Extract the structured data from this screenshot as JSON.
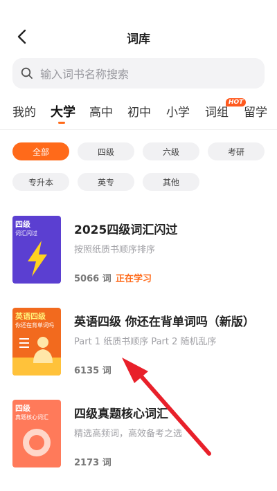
{
  "header": {
    "title": "词库"
  },
  "search": {
    "placeholder": "输入词书名称搜索"
  },
  "tabs": [
    {
      "label": "我的"
    },
    {
      "label": "大学"
    },
    {
      "label": "高中"
    },
    {
      "label": "初中"
    },
    {
      "label": "小学"
    },
    {
      "label": "词组"
    },
    {
      "label": "留学"
    }
  ],
  "hot_badge": "HOT",
  "filters": [
    {
      "label": "全部"
    },
    {
      "label": "四级"
    },
    {
      "label": "六级"
    },
    {
      "label": "考研"
    },
    {
      "label": "专升本"
    },
    {
      "label": "英专"
    },
    {
      "label": "其他"
    }
  ],
  "books": [
    {
      "title": "2025四级词汇闪过",
      "subtitle": "按照纸质书顺序排序",
      "count": "5066 词",
      "status": "正在学习",
      "cover_line1": "四级",
      "cover_line2": "词汇闪过",
      "cover_color": "#5b3fd1"
    },
    {
      "title": "英语四级 你还在背单词吗（新版）",
      "subtitle": "Part 1 纸质书顺序 Part 2 随机乱序",
      "count": "6135 词",
      "cover_line1": "英语四级",
      "cover_line2": "你还在背单词吗",
      "cover_color": "#f26a1e"
    },
    {
      "title": "四级真题核心词汇",
      "subtitle": "精选高频词，高效备考之选",
      "count": "2173 词",
      "cover_line1": "四级",
      "cover_line2": "真题核心词汇",
      "cover_color": "#ff7a5a"
    }
  ],
  "colors": {
    "accent": "#ff6a1a",
    "annotation_arrow": "#e8202a"
  }
}
